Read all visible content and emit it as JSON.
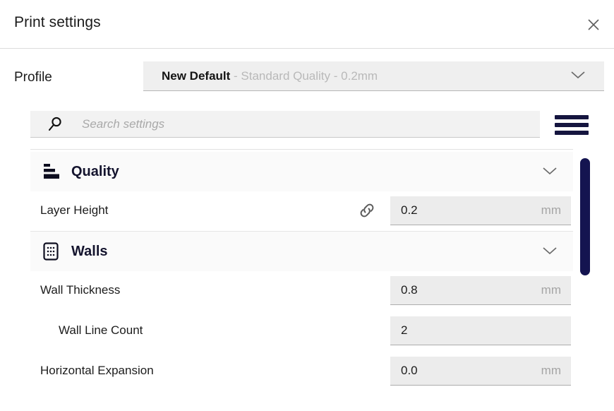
{
  "window": {
    "title": "Print settings",
    "close_icon": "close-icon"
  },
  "profile": {
    "label": "Profile",
    "value_primary": "New Default",
    "value_secondary": " - Standard Quality - 0.2mm",
    "chevron_icon": "chevron-down-icon"
  },
  "search": {
    "placeholder": "Search settings",
    "value": "",
    "icon": "search-icon",
    "menu_icon": "hamburger-menu-icon"
  },
  "sections": [
    {
      "title": "Quality",
      "icon": "layers-icon",
      "chevron_icon": "chevron-down-icon",
      "rows": [
        {
          "label": "Layer Height",
          "indent": 0,
          "linked": true,
          "link_icon": "link-icon",
          "value": "0.2",
          "unit": "mm"
        }
      ]
    },
    {
      "title": "Walls",
      "icon": "wall-dots-icon",
      "chevron_icon": "chevron-down-icon",
      "rows": [
        {
          "label": "Wall Thickness",
          "indent": 0,
          "linked": false,
          "value": "0.8",
          "unit": "mm"
        },
        {
          "label": "Wall Line Count",
          "indent": 1,
          "linked": false,
          "value": "2",
          "unit": ""
        },
        {
          "label": "Horizontal Expansion",
          "indent": 0,
          "linked": false,
          "value": "0.0",
          "unit": "mm"
        }
      ]
    }
  ],
  "scrollbar": {
    "name": "settings-scrollbar",
    "thumb_color": "#141450"
  },
  "colors": {
    "accent": "#141450",
    "field_bg": "#ececec",
    "section_bg": "#fafafa",
    "muted_text": "#a5a5a5"
  }
}
